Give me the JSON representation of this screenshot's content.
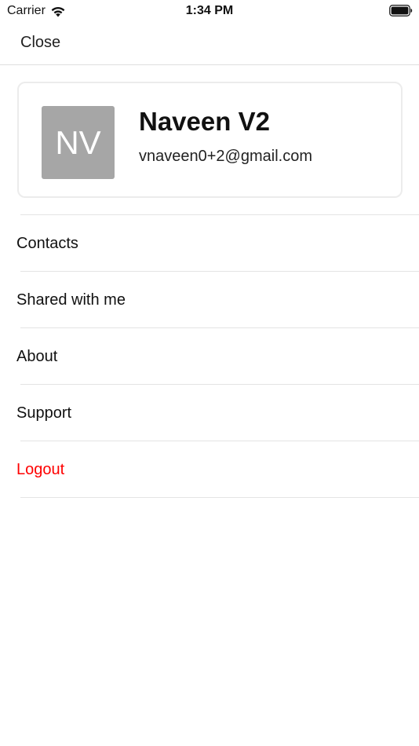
{
  "status_bar": {
    "carrier": "Carrier",
    "time": "1:34 PM",
    "icons": [
      "wifi-icon",
      "battery-icon"
    ]
  },
  "nav": {
    "close_label": "Close"
  },
  "profile": {
    "initials": "NV",
    "name": "Naveen V2",
    "email": "vnaveen0+2@gmail.com",
    "avatar_color": "#a6a6a6"
  },
  "menu": {
    "items": [
      {
        "label": "Contacts"
      },
      {
        "label": "Shared with me"
      },
      {
        "label": "About"
      },
      {
        "label": "Support"
      },
      {
        "label": "Logout"
      }
    ],
    "logout_color": "#ff0000"
  }
}
